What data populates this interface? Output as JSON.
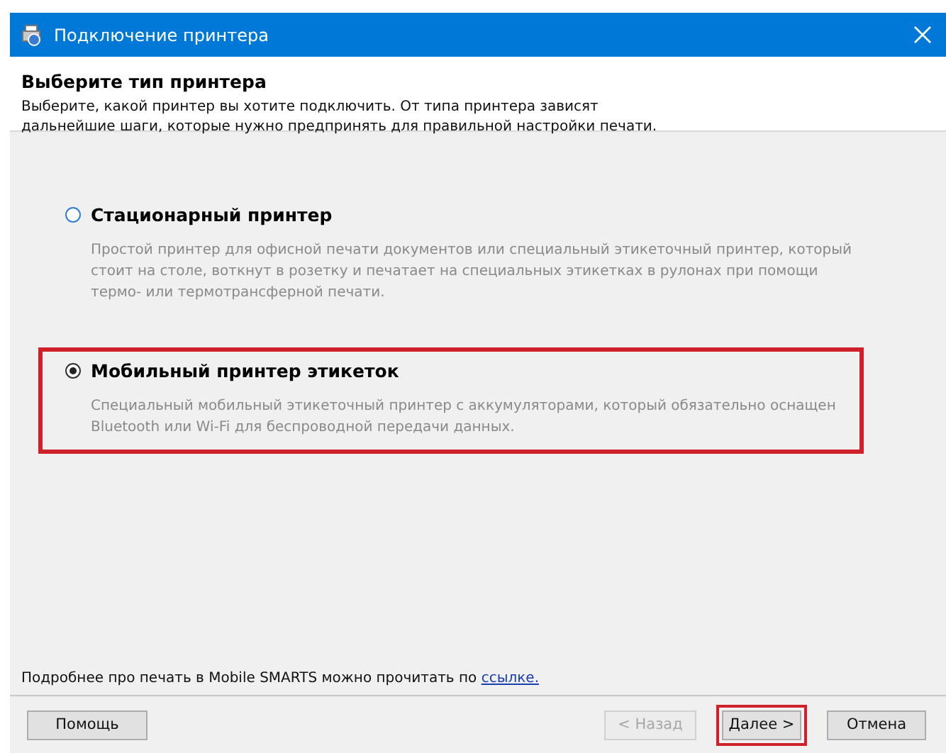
{
  "window": {
    "title": "Подключение принтера"
  },
  "header": {
    "title": "Выберите тип принтера",
    "description": "Выберите, какой принтер вы хотите подключить. От типа принтера зависят дальнейшие шаги, которые нужно предпринять для правильной настройки печати."
  },
  "options": [
    {
      "label": "Стационарный принтер",
      "description": "Простой принтер для офисной печати документов или специальный этикеточный принтер, который стоит на столе, воткнут в розетку и печатает на специальных этикетках в рулонах при помощи термо- или термотрансферной печати.",
      "selected": false,
      "highlighted": false
    },
    {
      "label": "Мобильный принтер этикеток",
      "description": "Специальный мобильный этикеточный принтер с аккумуляторами, который обязательно оснащен Bluetooth или Wi-Fi для беспроводной передачи данных.",
      "selected": true,
      "highlighted": true
    }
  ],
  "footer": {
    "text": "Подробнее про печать в Mobile SMARTS можно прочитать по ",
    "link": "ссылке."
  },
  "buttons": [
    {
      "label": "Помощь",
      "disabled": false,
      "highlighted": false
    },
    {
      "label": "< Назад",
      "disabled": true,
      "highlighted": false
    },
    {
      "label": "Далее >",
      "disabled": false,
      "highlighted": true
    },
    {
      "label": "Отмена",
      "disabled": false,
      "highlighted": false
    }
  ]
}
